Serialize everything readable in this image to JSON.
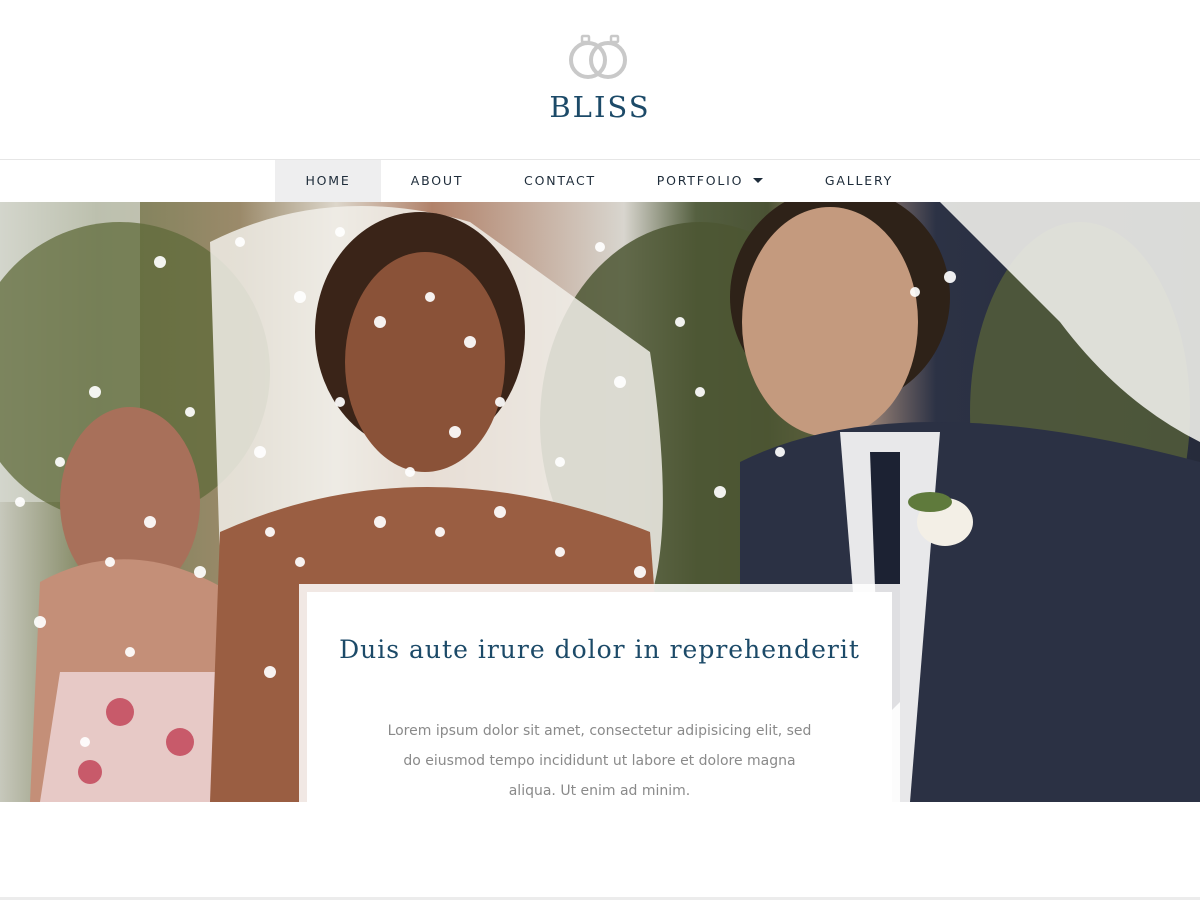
{
  "brand": {
    "name": "BLISS",
    "logo_icon": "wedding-rings-icon"
  },
  "nav": {
    "items": [
      {
        "label": "HOME",
        "active": true
      },
      {
        "label": "ABOUT",
        "active": false
      },
      {
        "label": "CONTACT",
        "active": false
      },
      {
        "label": "PORTFOLIO",
        "active": false,
        "has_dropdown": true
      },
      {
        "label": "GALLERY",
        "active": false
      }
    ]
  },
  "hero": {
    "image": "wedding-couple-confetti-photo",
    "caption": {
      "title": "Duis aute irure dolor in reprehenderit",
      "text": "Lorem ipsum dolor sit amet, consectetur adipisicing elit, sed do eiusmod tempo incididunt ut labore et dolore magna aliqua. Ut enim ad minim."
    }
  },
  "colors": {
    "brand": "#1c4a68",
    "nav_text": "#1e2c3a",
    "nav_active_bg": "#eeeeef",
    "body_text": "#8a8a8a",
    "logo_icon": "#c9c9c9"
  }
}
